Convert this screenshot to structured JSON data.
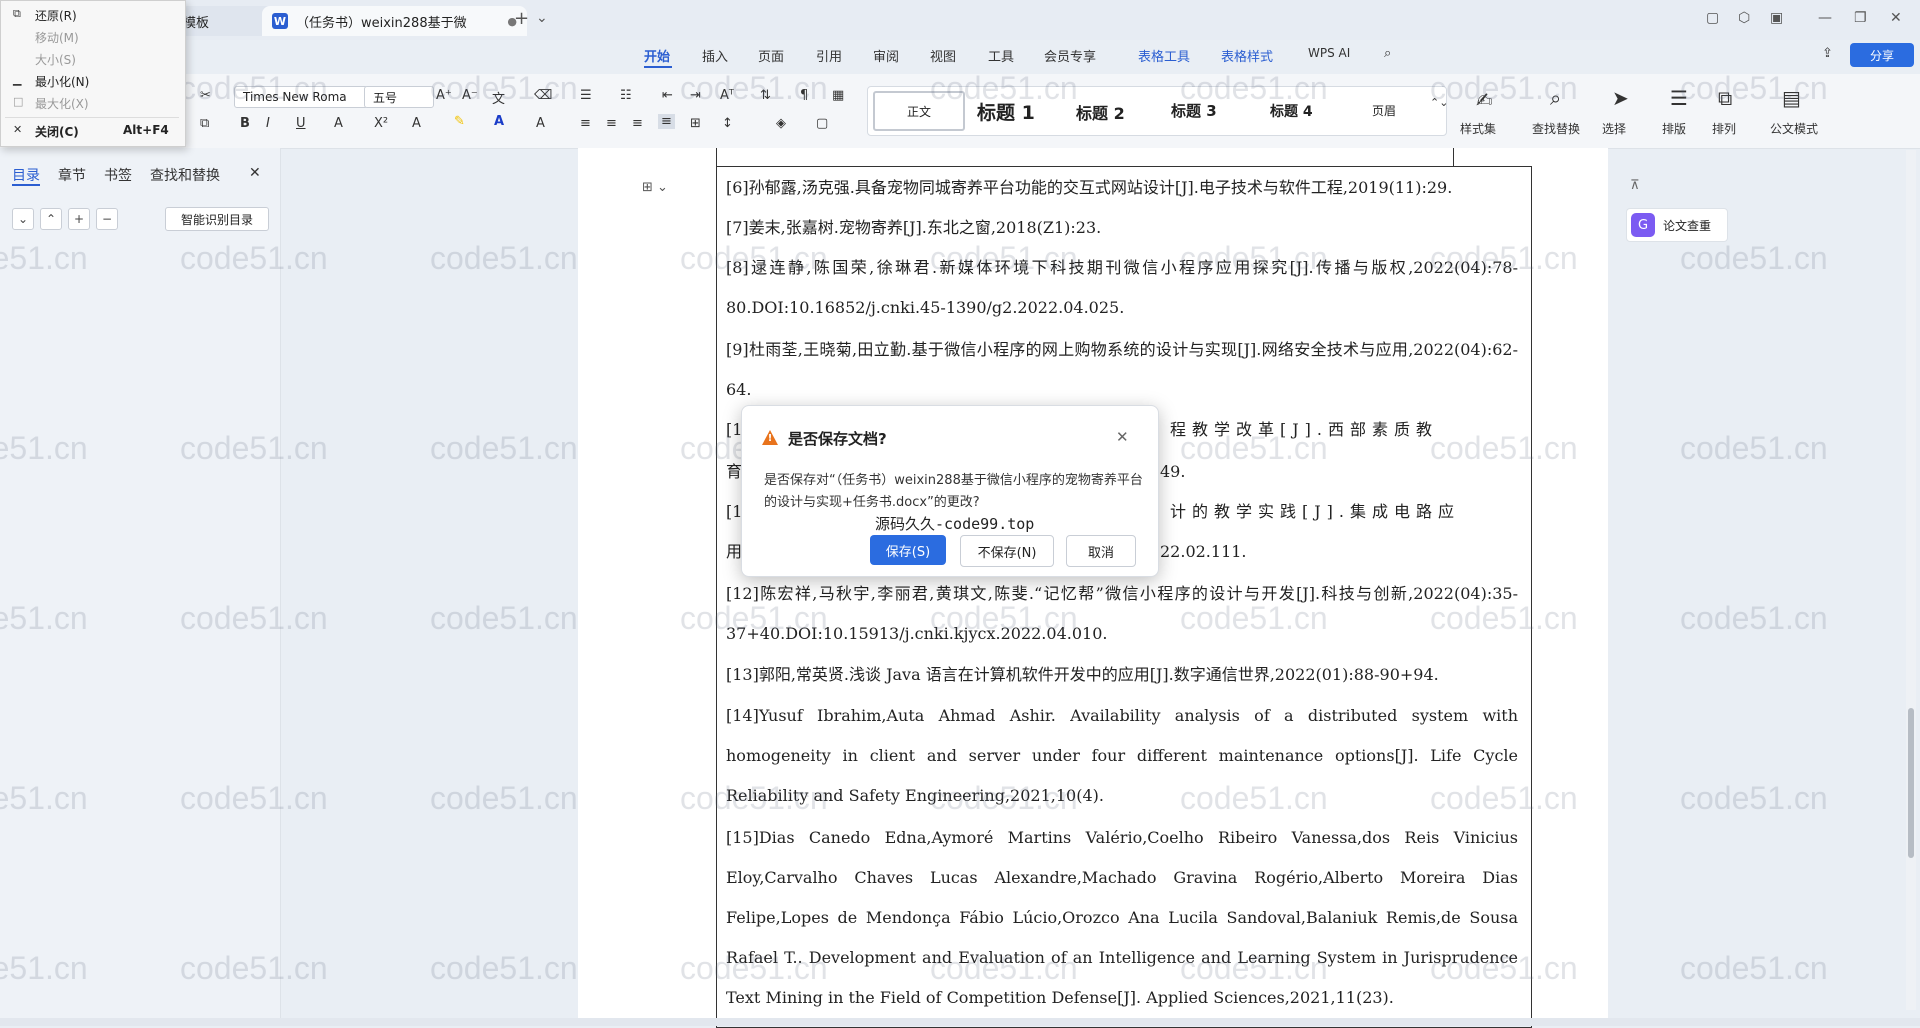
{
  "titlebar": {
    "inactive_tab": "壳模板",
    "active_tab": "（任务书）weixin288基于微",
    "doc_icon_letter": "W",
    "new_tab": "+"
  },
  "ribbon_tabs": [
    "开始",
    "插入",
    "页面",
    "引用",
    "审阅",
    "视图",
    "工具",
    "会员专享",
    "表格工具",
    "表格样式",
    "WPS AI"
  ],
  "share_label": "分享",
  "toolbar": {
    "font_name": "Times New Roma",
    "font_size": "五号",
    "styles": [
      "正文",
      "标题 1",
      "标题 2",
      "标题 3",
      "标题 4",
      "页眉"
    ],
    "style_set": "样式集",
    "find_replace": "查找替换",
    "select": "选择",
    "layout": "排版",
    "arrange": "排列",
    "doc_mode": "公文模式"
  },
  "nav": {
    "tabs": [
      "目录",
      "章节",
      "书签",
      "查找和替换"
    ],
    "smart_toc": "智能识别目录"
  },
  "sysmenu": {
    "items": [
      {
        "label": "还原(R)",
        "disabled": false
      },
      {
        "label": "移动(M)",
        "disabled": true
      },
      {
        "label": "大小(S)",
        "disabled": true
      },
      {
        "label": "最小化(N)",
        "disabled": false
      },
      {
        "label": "最大化(X)",
        "disabled": true
      },
      {
        "label": "关闭(C)",
        "shortcut": "Alt+F4",
        "disabled": false
      }
    ]
  },
  "document": {
    "refs": [
      "[6]孙郁露,汤克强.具备宠物同城寄养平台功能的交互式网站设计[J].电子技术与软件工程,2019(11):29.",
      "[7]姜末,张嘉树.宠物寄养[J].东北之窗,2018(Z1):23.",
      "[8]逯连静,陈国荣,徐琳君.新媒体环境下科技期刊微信小程序应用探究[J].传播与版权,2022(04):78-80.DOI:10.16852/j.cnki.45-1390/g2.2022.04.025.",
      "[9]杜雨荃,王晓菊,田立勤.基于微信小程序的网上购物系统的设计与实现[J].网络安全技术与应用,2022(04):62-64.",
      "[1",
      "程教学改革[J].西部素质教",
      "育",
      "49.",
      "[1",
      "计的教学实践[J].集成电路应",
      "用",
      "22.02.111.",
      "[12]陈宏祥,马秋宇,李丽君,黄琪文,陈斐.“记忆帮”微信小程序的设计与开发[J].科技与创新,2022(04):35-37+40.DOI:10.15913/j.cnki.kjycx.2022.04.010.",
      "[13]郭阳,常英贤.浅谈 Java 语言在计算机软件开发中的应用[J].数字通信世界,2022(01):88-90+94.",
      "[14]Yusuf Ibrahim,Auta Ahmad Ashir. Availability analysis of a distributed system with homogeneity in client and server under four different maintenance options[J]. Life Cycle Reliability and Safety Engineering,2021,10(4).",
      "[15]Dias Canedo Edna,Aymoré Martins Valério,Coelho Ribeiro Vanessa,dos Reis Vinicius Eloy,Carvalho Chaves Lucas Alexandre,Machado Gravina Rogério,Alberto Moreira Dias Felipe,Lopes de Mendonça Fábio Lúcio,Orozco Ana Lucila Sandoval,Balaniuk Remis,de Sousa Rafael T.. Development and Evaluation of an Intelligence and Learning System in Jurisprudence Text Mining in the Field of Competition Defense[J]. Applied Sciences,2021,11(23)."
    ]
  },
  "right_panel": {
    "paper_check": "论文查重"
  },
  "dialog": {
    "title": "是否保存文档?",
    "message": "是否保存对“（任务书）weixin288基于微信小程序的宠物寄养平台的设计与实现+任务书.docx”的更改?",
    "save": "保存(S)",
    "dont_save": "不保存(N)",
    "cancel": "取消",
    "overlay": "源码久久-code99.top"
  },
  "watermark": "code51.cn",
  "colors": {
    "accent": "#2b6ce0",
    "warn": "#e8731c",
    "ai_purple": "#7b5bf2"
  }
}
